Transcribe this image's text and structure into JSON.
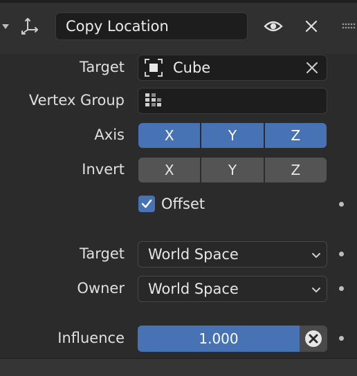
{
  "header": {
    "collapse_icon": "triangle-down-icon",
    "constraint_icon": "copy-location-constraint-icon",
    "name_value": "Copy Location",
    "visibility_icon": "eye-icon",
    "close_icon": "close-icon",
    "drag_icon": "drag-handle-icon"
  },
  "target": {
    "label": "Target",
    "object_icon": "object-eyedropper-icon",
    "value": "Cube",
    "clear_icon": "close-icon"
  },
  "vertex_group": {
    "label": "Vertex Group",
    "icon": "vertex-group-icon",
    "value": ""
  },
  "axis": {
    "label": "Axis",
    "options": [
      "X",
      "Y",
      "Z"
    ],
    "enabled": [
      true,
      true,
      true
    ]
  },
  "invert": {
    "label": "Invert",
    "options": [
      "X",
      "Y",
      "Z"
    ],
    "enabled": [
      false,
      false,
      false
    ]
  },
  "offset": {
    "label": "Offset",
    "checked": true
  },
  "target_space": {
    "label": "Target",
    "value": "World Space"
  },
  "owner_space": {
    "label": "Owner",
    "value": "World Space"
  },
  "influence": {
    "label": "Influence",
    "value": "1.000",
    "fraction": 1.0
  },
  "colors": {
    "accent": "#4772b3",
    "field_bg": "#1d1d1d",
    "panel_bg": "#2b2b2b",
    "header_bg": "#303030"
  }
}
